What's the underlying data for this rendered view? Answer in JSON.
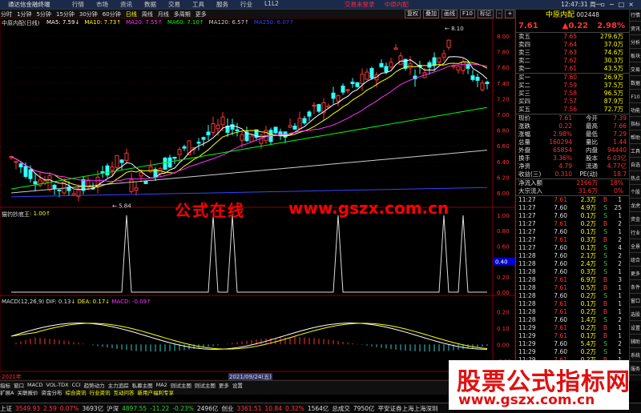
{
  "titlebar": {
    "app": "通达信金融终端",
    "menu": [
      "行情",
      "市场",
      "资讯",
      "数据",
      "交易",
      "工具",
      "服务",
      "行业",
      "L1L2"
    ],
    "center": [
      "交易未登录",
      "中原内配"
    ],
    "time": "12:47:31 周一"
  },
  "toolbar": {
    "periods": [
      "分时",
      "1分钟",
      "5分钟",
      "15分钟",
      "30分钟",
      "60分钟",
      "日线",
      "周线",
      "月线",
      "多周期",
      "更多"
    ],
    "active": "日线",
    "right": [
      "复权",
      "叠加",
      "画线",
      "F10",
      "标记",
      "-",
      "+",
      "分析"
    ]
  },
  "main": {
    "stock_label": "中原内配(日线)",
    "ma": [
      {
        "t": "MA5: 7.59↓",
        "c": "#ffffff"
      },
      {
        "t": "MA10: 7.73↑",
        "c": "#ffff00"
      },
      {
        "t": "MA20: 7.55↑",
        "c": "#ff33ff"
      },
      {
        "t": "MA60: 7.10↑",
        "c": "#00ff00"
      },
      {
        "t": "MA120: 6.57↑",
        "c": "#cccccc"
      },
      {
        "t": "MA250: 6.07↑",
        "c": "#3344ff"
      }
    ],
    "price_ticks": [
      "8.00",
      "7.80",
      "7.60",
      "7.40",
      "7.20",
      "7.00",
      "6.80",
      "6.60",
      "6.40",
      "6.20",
      "6.00"
    ],
    "high_mark": "8.10",
    "low_mark": "5.84",
    "ind_label": "猫钓抄底王",
    "ind_value": ": 1.00↑",
    "ind_ticks": [
      "1.00",
      "0.80",
      "0.60",
      "0.40",
      "0.20",
      "0.00"
    ],
    "ind_marker": "0.40",
    "macd_label": "MACD(12,26,9)",
    "macd_dif": "DIF: 0.13↓",
    "macd_dea": "DEA: 0.17↓",
    "macd_macd": "MACD: -0.09↑",
    "macd_ticks": [
      "0.20",
      "0.10",
      "0.00",
      "-0.10"
    ],
    "dates": [
      "2021年",
      "2021/09/24(五)"
    ],
    "watermark1": "公式在线",
    "watermark2": "www.gszx.com.cn"
  },
  "quote": {
    "title": "中原内配",
    "code": "002448",
    "price": "7.61",
    "change": "▲0.22",
    "pct": "2.98%",
    "asks": [
      [
        "卖五",
        "7.65",
        "279.6万"
      ],
      [
        "卖四",
        "7.64",
        "37.0万"
      ],
      [
        "卖三",
        "7.63",
        "74.6万"
      ],
      [
        "卖二",
        "7.62",
        "30.3万"
      ],
      [
        "卖一",
        "7.61",
        "43.5万"
      ]
    ],
    "bids": [
      [
        "买一",
        "7.60",
        "26.9万"
      ],
      [
        "买二",
        "7.59",
        "37.5万"
      ],
      [
        "买三",
        "7.58",
        "96.5万"
      ],
      [
        "买四",
        "7.57",
        "87.9万"
      ],
      [
        "买五",
        "7.56",
        "72.7万"
      ]
    ],
    "stats": [
      [
        "现价",
        "7.61",
        "今开",
        "7.39"
      ],
      [
        "涨跌",
        "0.22",
        "最高",
        "7.66"
      ],
      [
        "涨幅",
        "2.98%",
        "最低",
        "7.29"
      ],
      [
        "总量",
        "160294",
        "量比",
        "1.44"
      ],
      [
        "外盘",
        "65854",
        "内盘",
        "94440"
      ],
      [
        "换手",
        "3.36%",
        "股本",
        "6.03亿"
      ],
      [
        "净资",
        "4.79",
        "流通",
        "4.77亿"
      ],
      [
        "收益(三)",
        "0.310",
        "PE(动)",
        "18.7"
      ]
    ],
    "flow": [
      [
        "净流入额",
        "2166万",
        "18%"
      ],
      [
        "大宗流入",
        "31.6万",
        "0%"
      ]
    ],
    "ticks": [
      [
        "11:27",
        "7.61",
        "2.3万",
        "B",
        "1"
      ],
      [
        "11:27",
        "7.60",
        "4.9万",
        "S",
        "25"
      ],
      [
        "11:27",
        "7.60",
        "0.1万",
        "S",
        "1"
      ],
      [
        "11:27",
        "7.61",
        "0.2万",
        "B",
        "2"
      ],
      [
        "11:27",
        "7.60",
        "0.1万",
        "S",
        "1"
      ],
      [
        "11:27",
        "7.61",
        "0.3万",
        "B",
        "2"
      ],
      [
        "11:27",
        "7.60",
        "0.1万",
        "S",
        "4"
      ],
      [
        "11:28",
        "7.60",
        "2.1万",
        "S",
        "2"
      ],
      [
        "11:28",
        "7.60",
        "2.4万",
        "S",
        "2"
      ],
      [
        "11:28",
        "7.60",
        "0.3万",
        "S",
        "1"
      ],
      [
        "11:28",
        "7.61",
        "6.9万",
        "B",
        "3"
      ],
      [
        "11:28",
        "7.61",
        "0.5万",
        "B",
        "1"
      ],
      [
        "11:28",
        "7.60",
        "0.2万",
        "S",
        "1"
      ],
      [
        "11:28",
        "7.61",
        "0.1万",
        "B",
        "1"
      ],
      [
        "11:28",
        "7.61",
        "0.2万",
        "B",
        "1"
      ],
      [
        "11:28",
        "7.60",
        "1.4万",
        "S",
        "2"
      ],
      [
        "11:29",
        "7.61",
        "0.2万",
        "B",
        "1"
      ],
      [
        "11:29",
        "7.61",
        "0.1万",
        "B",
        "1"
      ],
      [
        "11:29",
        "7.60",
        "5.4万",
        "S",
        "2"
      ],
      [
        "11:29",
        "7.60",
        "0.2万",
        "S",
        "1"
      ],
      [
        "11:29",
        "7.61",
        "0.2万",
        "B",
        "1"
      ],
      [
        "11:29",
        "7.61",
        "0.1万",
        "B",
        "1"
      ]
    ]
  },
  "sidebar": [
    "行情",
    "资讯",
    "分析",
    "板块",
    "交易",
    "数据",
    "F10",
    "功能",
    "指标",
    "帮助",
    "工具",
    "自选",
    "热点",
    "个股",
    "龙虎",
    "资金",
    "行业",
    "全景",
    "组合",
    "更多",
    "条件",
    "窗口",
    "选股",
    "设置",
    "辅助",
    "系统",
    "服务"
  ],
  "bottom": {
    "row1": [
      "指标",
      "窗口",
      "MACD",
      "VOL-TDX",
      "CCI",
      "趋势动力",
      "主力追踪",
      "私募主图",
      "MA2",
      "则试主图",
      "则试主图",
      "更多",
      "设置"
    ],
    "row2": [
      "扩展A",
      "关联报价",
      "资金分布",
      "综合资讯",
      "行业资讯",
      "互动问答",
      "新用户福利专享"
    ]
  },
  "status": [
    {
      "t": "上证",
      "c": "wh"
    },
    {
      "t": "3549.93",
      "c": "up"
    },
    {
      "t": "2.59",
      "c": "up"
    },
    {
      "t": "0.07%",
      "c": "up"
    },
    {
      "t": "3693亿",
      "c": "wh"
    },
    {
      "t": "沪深",
      "c": "wh"
    },
    {
      "t": "4897.55",
      "c": "dn"
    },
    {
      "t": "-11.22",
      "c": "dn"
    },
    {
      "t": "-0.23%",
      "c": "dn"
    },
    {
      "t": "2496亿",
      "c": "wh"
    },
    {
      "t": "创业",
      "c": "wh"
    },
    {
      "t": "3361.51",
      "c": "up"
    },
    {
      "t": "10.84",
      "c": "up"
    },
    {
      "t": "0.32%",
      "c": "up"
    },
    {
      "t": "1564亿",
      "c": "wh"
    },
    {
      "t": "总成交",
      "c": "wh"
    },
    {
      "t": "7950亿",
      "c": "wh"
    },
    {
      "t": "平安证券上海上海深圳",
      "c": "wh"
    }
  ],
  "banner": {
    "line1": "股票公式指标网",
    "line2": "www.gszx.com.cn"
  },
  "colors": {
    "up": "#ff3333",
    "down": "#33cc33",
    "bg": "#000000",
    "accent": "#ffff00"
  }
}
